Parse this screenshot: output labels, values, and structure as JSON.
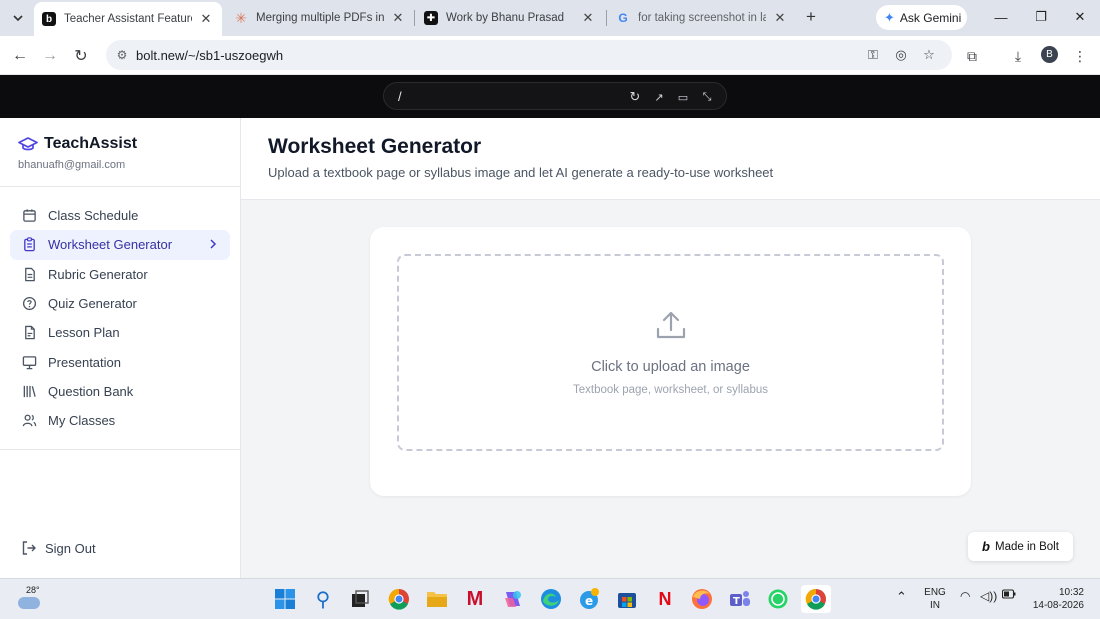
{
  "browser": {
    "tabs": [
      {
        "title": "Teacher Assistant Feature Su",
        "active": true
      },
      {
        "title": "Merging multiple PDFs into",
        "active": false
      },
      {
        "title": "Work by Bhanu Prasad",
        "active": false
      },
      {
        "title": "for taking screenshot in lapt",
        "active": false
      }
    ],
    "gemini_label": "Ask Gemini",
    "url": "bolt.new/~/sb1-uszoegwh",
    "profile_initial": "B"
  },
  "bolt": {
    "path": "/",
    "badge_label": "Made in Bolt"
  },
  "app": {
    "brand": "TeachAssist",
    "email": "bhanuafh@gmail.com",
    "nav": [
      {
        "label": "Class Schedule",
        "icon": "calendar-icon"
      },
      {
        "label": "Worksheet Generator",
        "icon": "clipboard-icon",
        "active": true
      },
      {
        "label": "Rubric Generator",
        "icon": "document-icon"
      },
      {
        "label": "Quiz Generator",
        "icon": "help-circle-icon"
      },
      {
        "label": "Lesson Plan",
        "icon": "file-icon"
      },
      {
        "label": "Presentation",
        "icon": "presentation-icon"
      },
      {
        "label": "Question Bank",
        "icon": "library-icon"
      },
      {
        "label": "My Classes",
        "icon": "users-icon"
      }
    ],
    "sign_out": "Sign Out",
    "page_title": "Worksheet Generator",
    "page_subtitle": "Upload a textbook page or syllabus image and let AI generate a ready-to-use worksheet",
    "upload": {
      "title": "Click to upload an image",
      "subtitle": "Textbook page, worksheet, or syllabus"
    }
  },
  "taskbar": {
    "temperature": "28°",
    "lang_top": "ENG",
    "lang_bottom": "IN",
    "time": "10:32",
    "date": "14-08-2026"
  },
  "colors": {
    "accent": "#3730a3",
    "active_bg": "#eef2ff",
    "main_bg": "#f3f4f6",
    "bolt_bar": "#0c0c0e"
  }
}
